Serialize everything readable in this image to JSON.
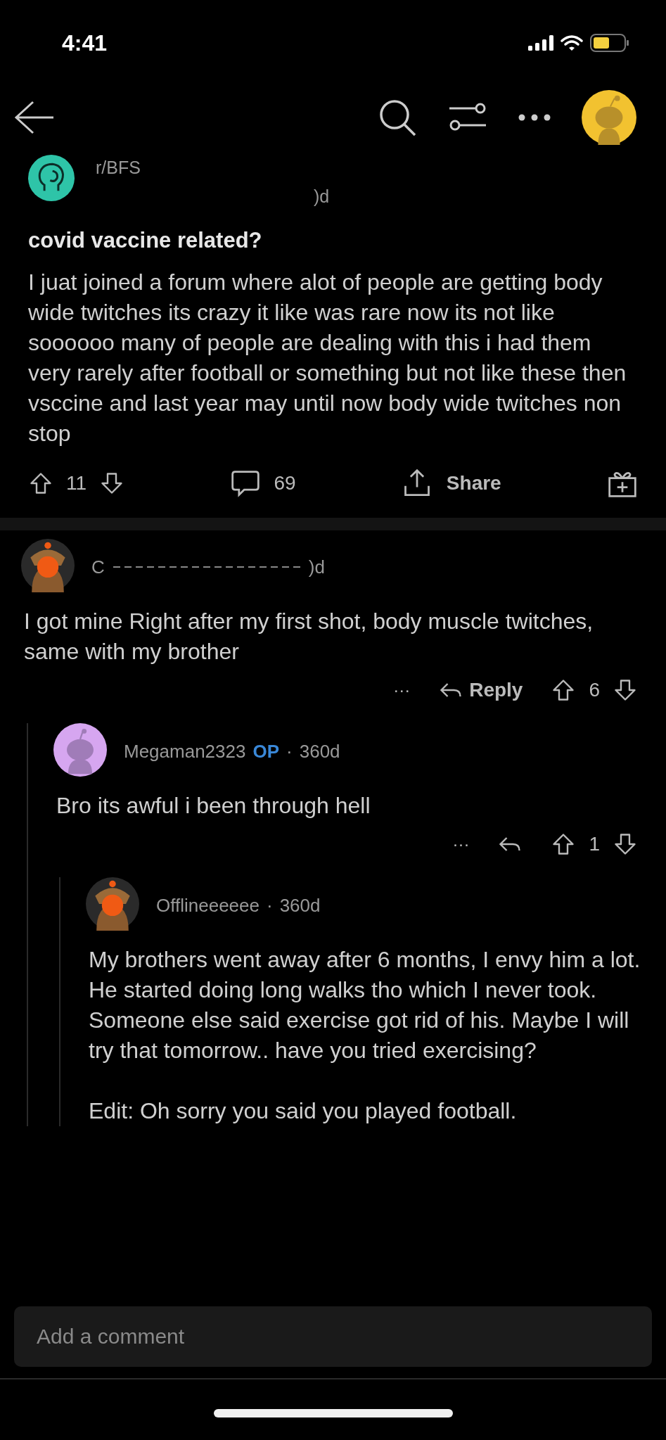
{
  "status_bar": {
    "time": "4:41"
  },
  "post": {
    "subreddit": "r/BFS",
    "age": ")d",
    "title": "covid vaccine related?",
    "body": "I juat joined a forum where alot of people are getting body wide twitches its crazy it like was rare now its not like soooooo many of people are dealing with this i had them very rarely after football or something but not like these then vsccine and last year may until now body wide twitches non stop",
    "score": "11",
    "comments": "69",
    "share": "Share"
  },
  "comments": [
    {
      "kind": "owl",
      "author": "C",
      "redacted": true,
      "is_op": false,
      "age": ")d",
      "body": "I got mine Right after my first shot, body muscle twitches, same with my brother",
      "more": "···",
      "reply_label": "Reply",
      "score": "6",
      "children": [
        {
          "kind": "snoo",
          "author": "Megaman2323",
          "redacted": false,
          "is_op": true,
          "op_label": "OP",
          "separator": "·",
          "age": "360d",
          "body": "Bro its awful i been through  hell",
          "more": "···",
          "score": "1",
          "children": [
            {
              "kind": "owl",
              "author": "Offlineeeeee",
              "redacted": false,
              "is_op": false,
              "separator": "·",
              "age": "360d",
              "body": "My brothers went away after 6 months, I envy him a lot. He started doing long walks tho which I never took. Someone else said exercise got rid of his. Maybe I will try that tomorrow.. have you tried exercising?\n\nEdit: Oh sorry you said you played football."
            }
          ]
        }
      ]
    }
  ],
  "composer": {
    "placeholder": "Add a comment"
  }
}
